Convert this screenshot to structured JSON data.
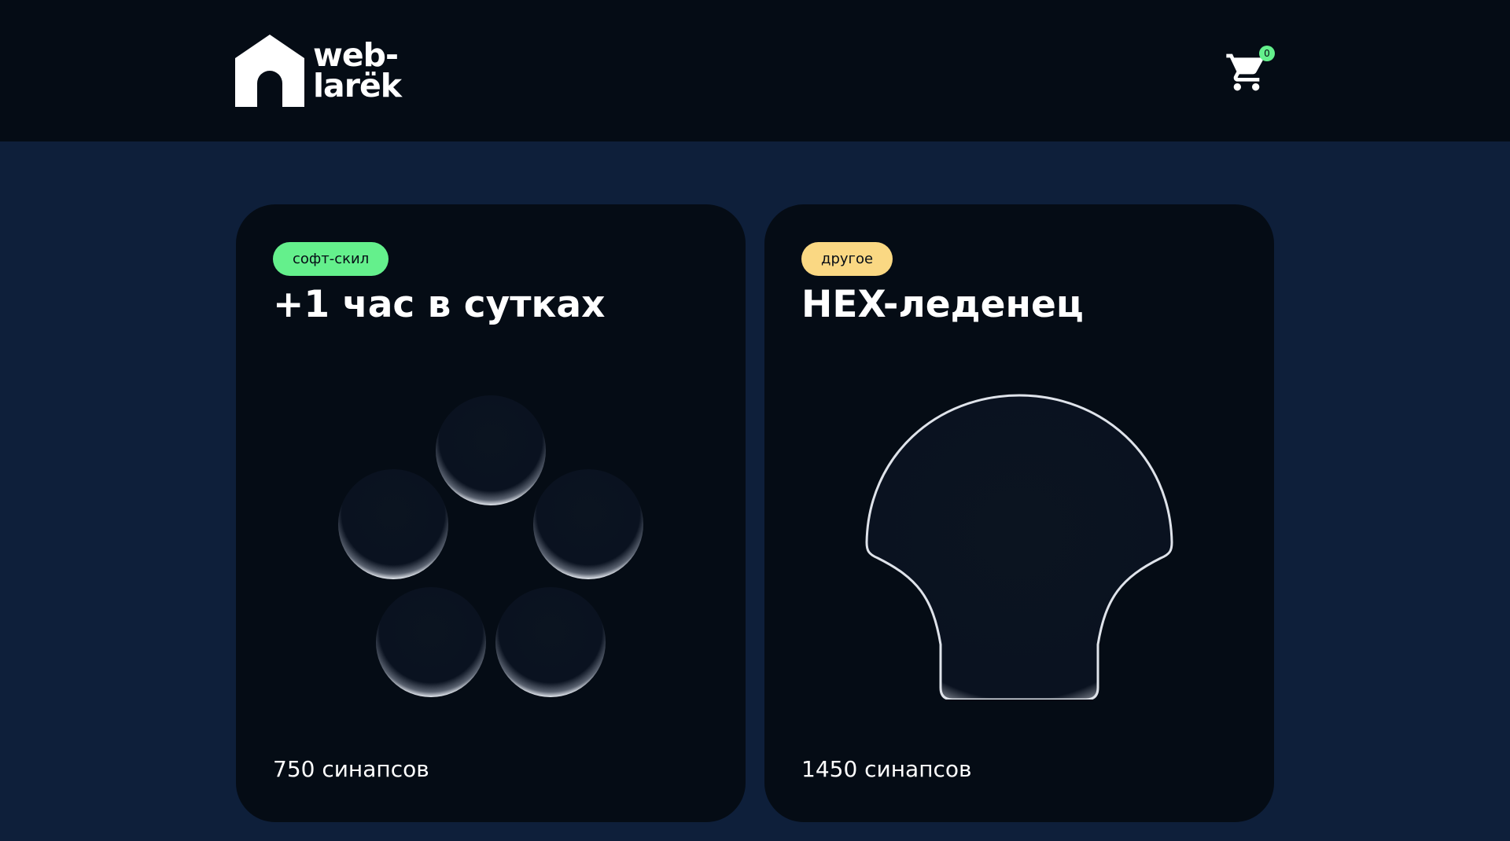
{
  "header": {
    "logo_line1": "web-",
    "logo_line2": "larёk",
    "cart_counter": "0"
  },
  "cards": [
    {
      "category": "софт-скил",
      "category_color": "#64f08c",
      "title": "+1 час в сутках",
      "price": "750 синапсов",
      "image": "five-bubbles"
    },
    {
      "category": "другое",
      "category_color": "#fad883",
      "title": "HEX-леденец",
      "price": "1450 синапсов",
      "image": "shell-lollipop"
    }
  ]
}
